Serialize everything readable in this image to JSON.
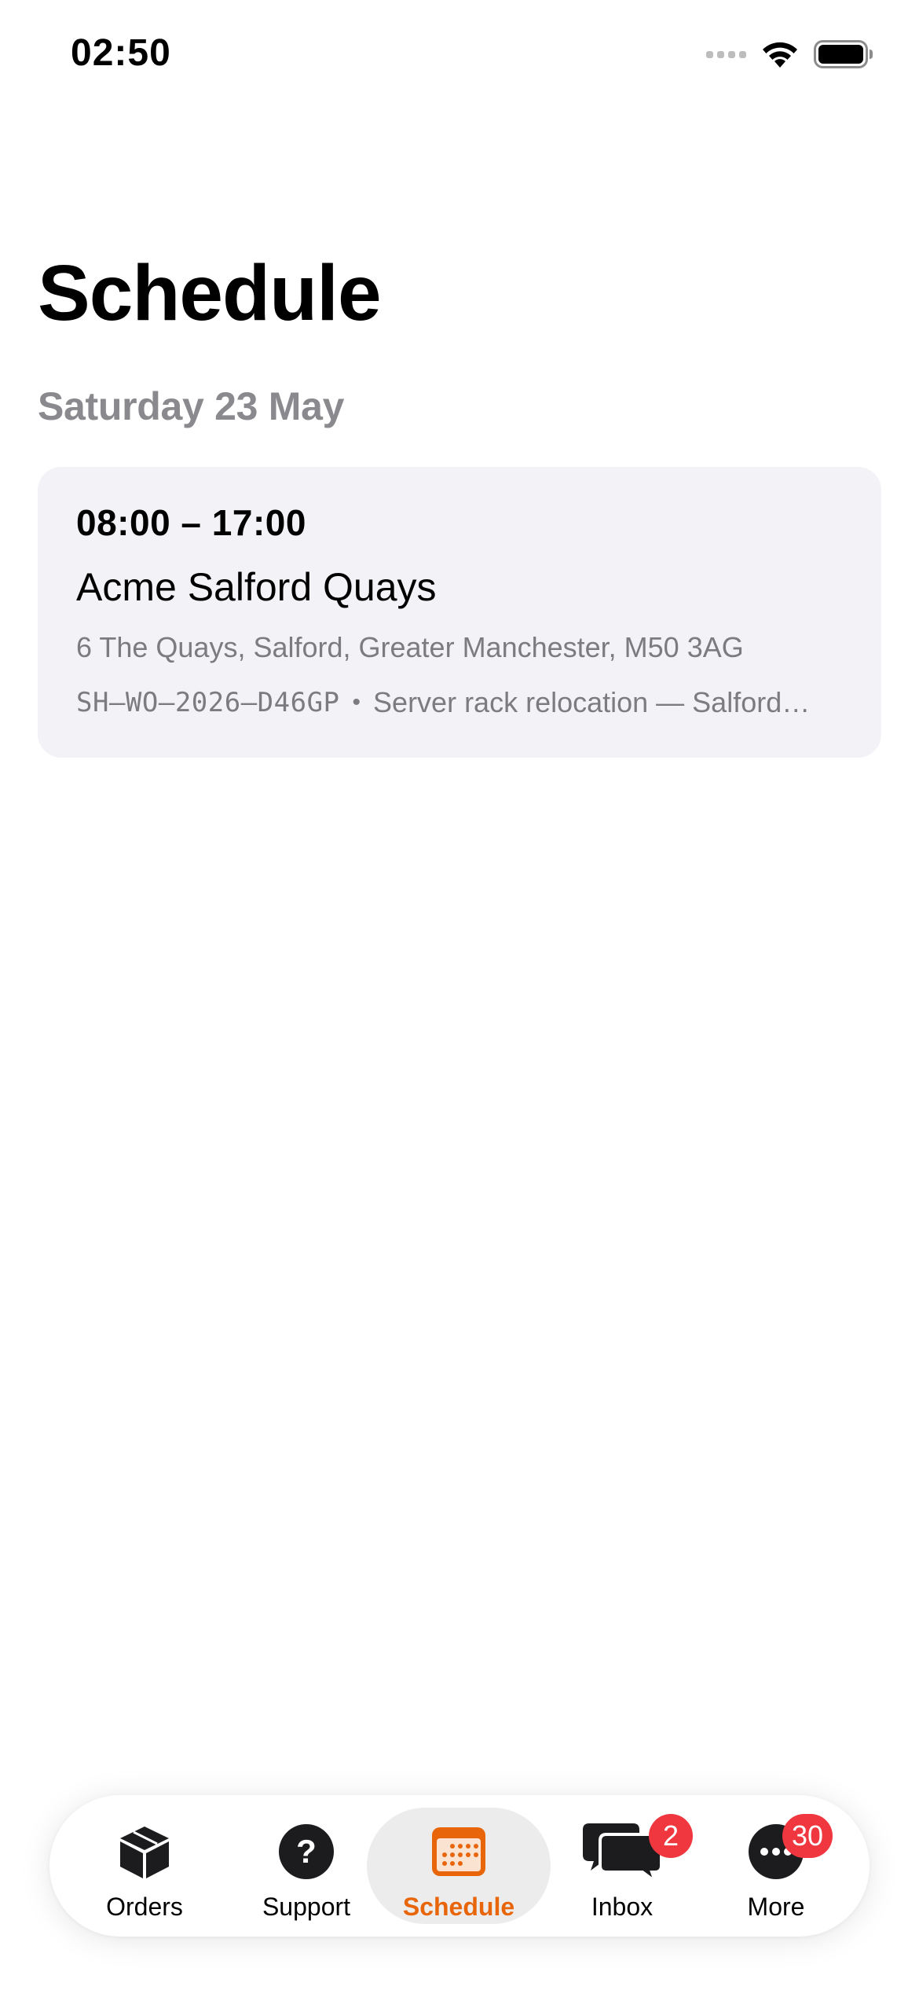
{
  "status_bar": {
    "time": "02:50"
  },
  "header": {
    "title": "Schedule",
    "date": "Saturday 23 May"
  },
  "appointment": {
    "time_range": "08:00 – 17:00",
    "site": "Acme Salford Quays",
    "address": "6 The Quays, Salford, Greater Manchester, M50 3AG",
    "reference": "SH–WO–2026–D46GP",
    "separator": "•",
    "description": "Server rack relocation — Salford…"
  },
  "tab_bar": {
    "tabs": [
      {
        "label": "Orders",
        "icon": "box-icon"
      },
      {
        "label": "Support",
        "icon": "question-circle-icon"
      },
      {
        "label": "Schedule",
        "icon": "calendar-icon",
        "active": true
      },
      {
        "label": "Inbox",
        "icon": "chat-bubbles-icon",
        "badge": "2"
      },
      {
        "label": "More",
        "icon": "ellipsis-circle-icon",
        "badge": "30"
      }
    ]
  },
  "colors": {
    "accent": "#E8650A",
    "badge": "#F0373F",
    "card_background": "#F2F2F7",
    "secondary_text": "#8A8A8E"
  }
}
